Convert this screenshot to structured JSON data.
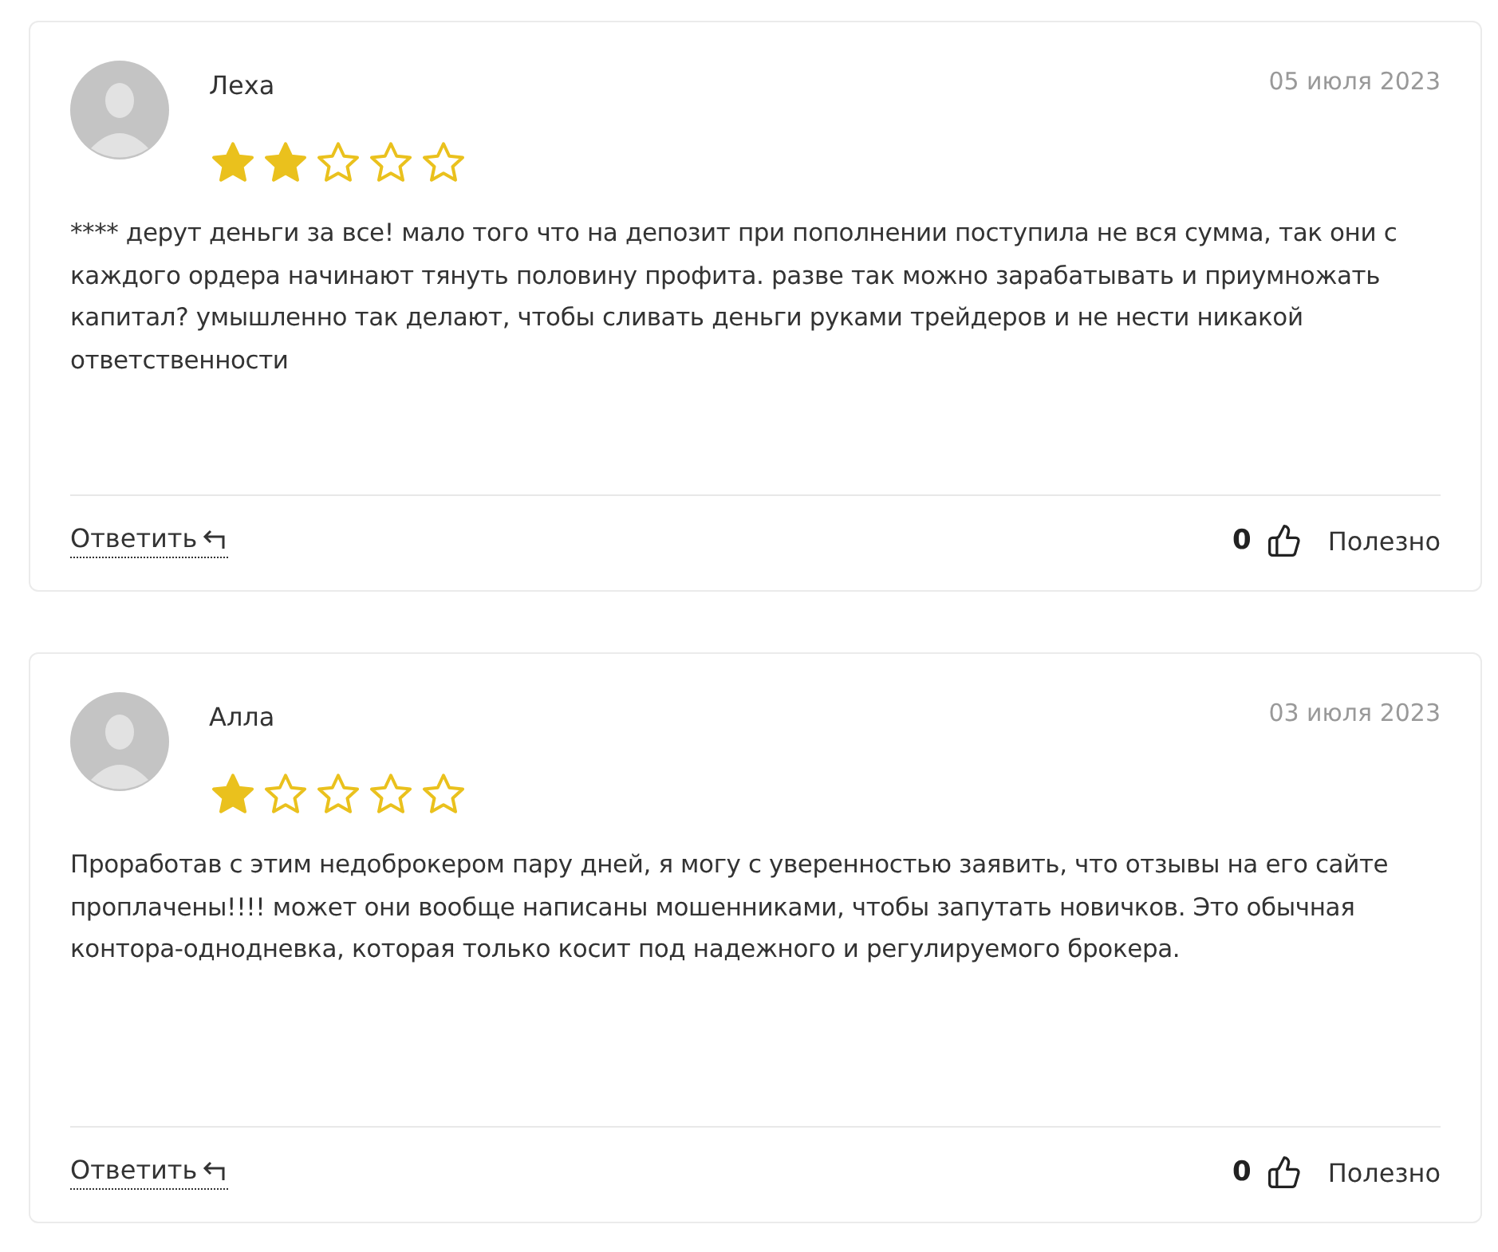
{
  "reviews": [
    {
      "author": "Леха",
      "date": "05 июля 2023",
      "stars": 2,
      "text": "**** дерут деньги за все! мало того что на депозит при пополнении поступила не вся сумма, так они с каждого ордера начинают тянуть половину профита. разве так можно зарабатывать и приумножать капитал? умышленно так делают, чтобы сливать деньги руками трейдеров и не нести никакой ответственности",
      "reply": "Ответить",
      "likes": "0",
      "helpful": "Полезно"
    },
    {
      "author": "Алла",
      "date": "03 июля 2023",
      "stars": 1,
      "text": "Проработав с этим недоброкером пару дней, я могу с уверенностью заявить, что отзывы на его сайте проплачены!!!! может они вообще написаны мошенниками, чтобы запутать новичков. Это обычная контора-однодневка, которая только косит под надежного и регулируемого брокера.",
      "reply": "Ответить",
      "likes": "0",
      "helpful": "Полезно"
    }
  ]
}
